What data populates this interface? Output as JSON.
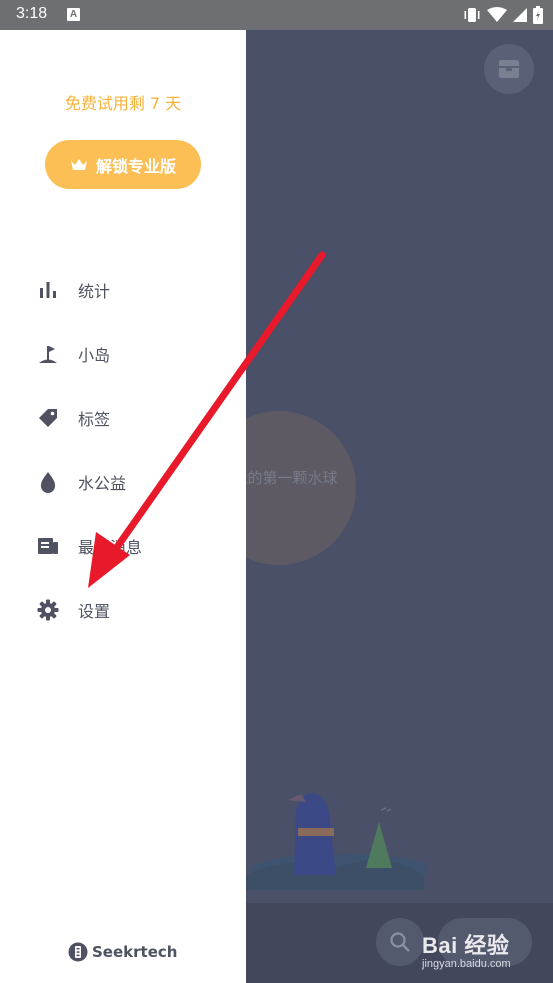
{
  "status_bar": {
    "time": "3:18",
    "notification_badge": "A"
  },
  "background_app": {
    "water_ball_label": "我的第一颗水球",
    "scene": "mountain-scene-illustration"
  },
  "drawer": {
    "trial_text": "免费试用剩 7 天",
    "unlock_button": "解锁专业版",
    "menu": [
      {
        "label": "统计",
        "icon": "bar-chart-icon"
      },
      {
        "label": "小岛",
        "icon": "flag-icon"
      },
      {
        "label": "标签",
        "icon": "tag-icon"
      },
      {
        "label": "水公益",
        "icon": "water-drop-icon"
      },
      {
        "label": "最新消息",
        "icon": "news-icon"
      },
      {
        "label": "设置",
        "icon": "gear-icon"
      }
    ],
    "brand": "Seekrtech"
  },
  "watermark": {
    "main": "Bai 经验",
    "sub": "jingyan.baidu.com"
  },
  "colors": {
    "accent": "#fcbf55",
    "trial_text": "#f7b23b",
    "annotation_red": "#e8192a",
    "overlay_bg": "#4a5068"
  }
}
